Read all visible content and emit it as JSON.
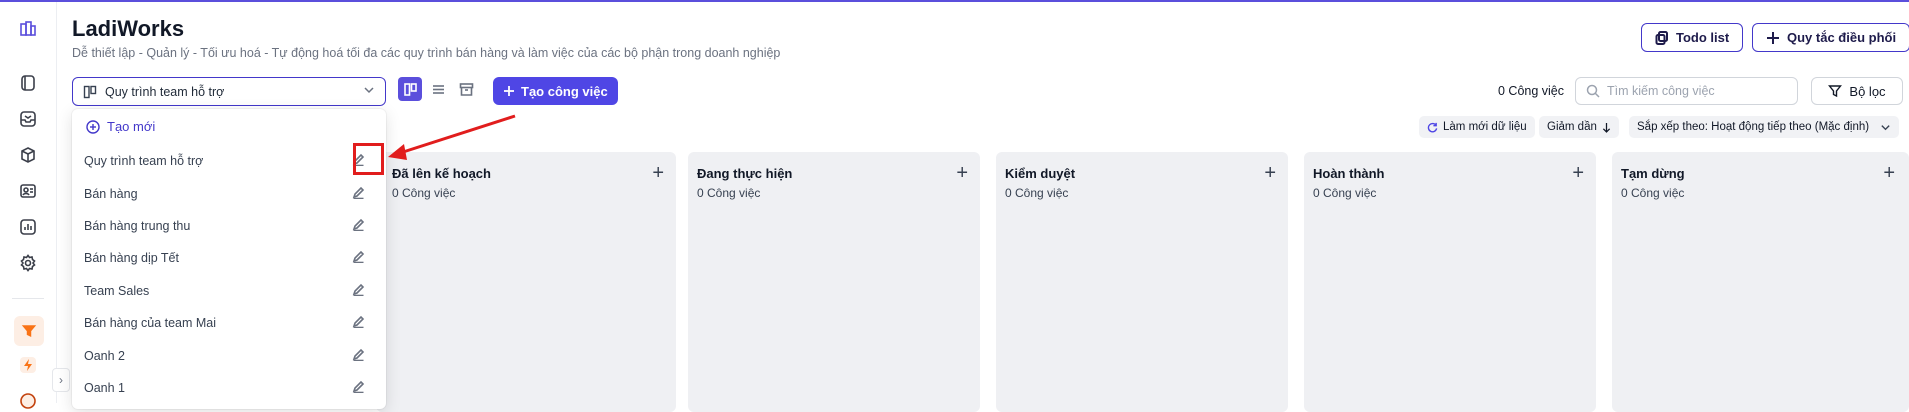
{
  "header": {
    "title": "LadiWorks",
    "subtitle": "Dễ thiết lập - Quản lý - Tối ưu hoá - Tự động hoá tối đa các quy trình bán hàng và làm việc của các bộ phận trong doanh nghiệp",
    "todo_label": "Todo list",
    "rules_label": "Quy tắc điều phối"
  },
  "toolbar": {
    "workflow_selected": "Quy trình team hỗ trợ",
    "create_task_label": "Tạo công việc",
    "task_count": "0 Công việc",
    "search_placeholder": "Tìm kiếm công việc",
    "filter_label": "Bộ lọc",
    "refresh_label": "Làm mới dữ liệu",
    "order_label": "Giảm dần",
    "sort_label": "Sắp xếp theo: Hoạt động tiếp theo (Mặc định)"
  },
  "dropdown": {
    "new_label": "Tạo mới",
    "items": [
      "Quy trình team hỗ trợ",
      "Bán hàng",
      "Bán hàng trung thu",
      "Bán hàng dịp Tết",
      "Team Sales",
      "Bán hàng của team Mai",
      "Oanh 2",
      "Oanh 1"
    ]
  },
  "columns": [
    {
      "name": "Đã lên kế hoạch",
      "count": "0 Công việc"
    },
    {
      "name": "Đang thực hiện",
      "count": "0 Công việc"
    },
    {
      "name": "Kiểm duyệt",
      "count": "0 Công việc"
    },
    {
      "name": "Hoàn thành",
      "count": "0 Công việc"
    },
    {
      "name": "Tạm dừng",
      "count": "0 Công việc"
    }
  ],
  "sidebar_icons": [
    "workspace-icon",
    "book-icon",
    "inbox-icon",
    "box-icon",
    "contact-card-icon",
    "chart-icon",
    "settings-icon",
    "funnel-icon",
    "lightning-icon",
    "globe-icon"
  ],
  "colors": {
    "accent": "#4f46e5",
    "highlight": "#e11d1d",
    "column_bg": "#eff0f3"
  }
}
